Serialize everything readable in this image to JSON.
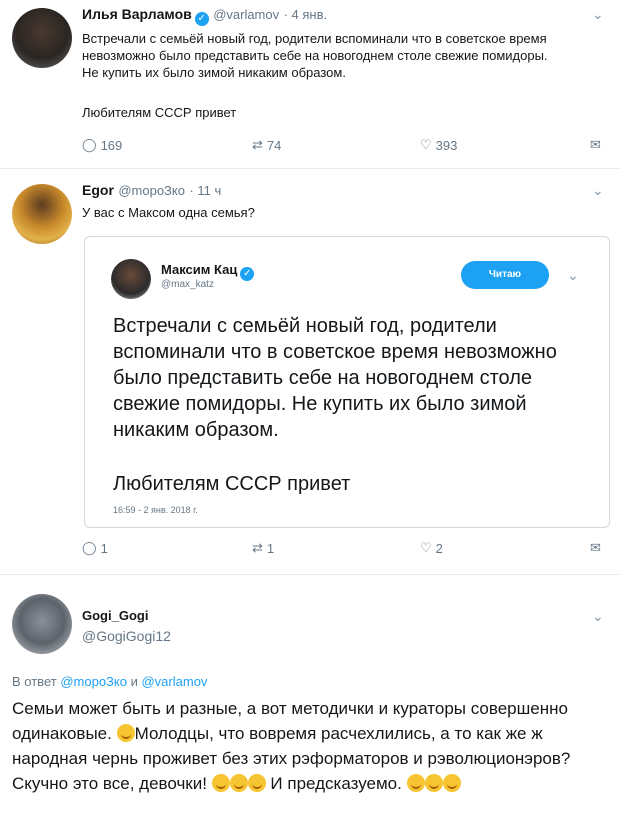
{
  "tweet1": {
    "name": "Илья Варламов",
    "handle": "@varlamov",
    "date": "· 4 янв.",
    "text": "Встречали с семьёй новый год, родители вспоминали что в советское время невозможно было представить себе на новогоднем столе свежие помидоры. Не купить их было зимой никаким образом.",
    "text2": "Любителям СССР привет",
    "replies": "169",
    "retweets": "74",
    "likes": "393"
  },
  "tweet2": {
    "name": "Egor",
    "handle": "@moроЗко",
    "date": "· 11 ч",
    "text": "У вас с Максом одна семья?",
    "replies": "1",
    "retweets": "1",
    "likes": "2",
    "quote": {
      "name": "Максим Кац",
      "handle": "@max_katz",
      "follow_label": "Читаю",
      "text": "Встречали с семьёй новый год, родители вспоминали что в советское время невозможно было представить себе на новогоднем столе свежие помидоры. Не купить их было зимой никаким образом.",
      "text2": "Любителям СССР привет",
      "timestamp": "16:59 - 2 янв. 2018 г."
    }
  },
  "tweet3": {
    "name": "Gogi_Gogi",
    "handle": "@GogiGogi12",
    "reply_prefix": "В ответ",
    "reply_to_1": "@moроЗко",
    "reply_and": "и",
    "reply_to_2": "@varlamov",
    "text_part1": "Семьи может быть и разные, а вот методички и кураторы совершенно одинаковые.",
    "text_part2": "Молодцы, что вовремя расчехлились, а то как же ж народная чернь проживет без этих рэформаторов и рэволюционэров? Скучно это все, девочки!",
    "text_part3": "И предсказуемо."
  },
  "colors": {
    "link": "#1da1f2",
    "muted": "#657786",
    "follow_bg": "#1da1f2"
  },
  "icons": [
    "reply-icon",
    "retweet-icon",
    "like-icon",
    "message-icon",
    "chevron-down-icon",
    "verified-icon"
  ]
}
